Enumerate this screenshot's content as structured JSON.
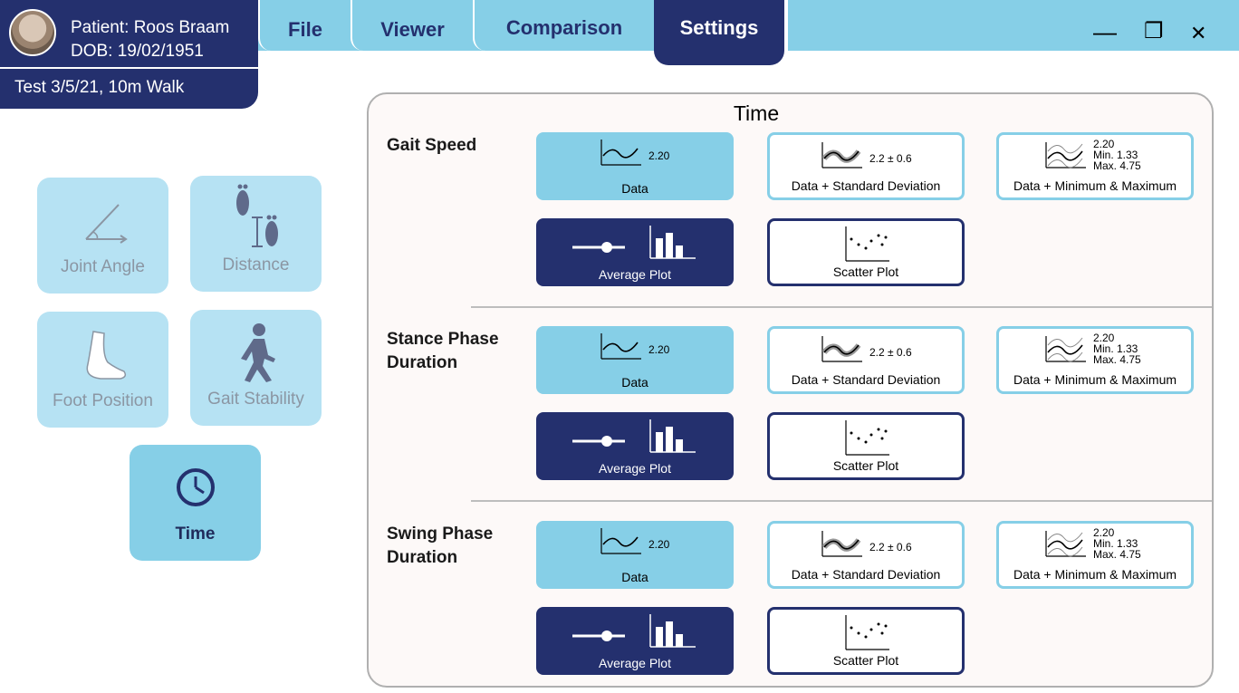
{
  "patient": {
    "name": "Patient: Roos Braam",
    "dob": "DOB: 19/02/1951",
    "test": "Test 3/5/21, 10m Walk"
  },
  "tabs": [
    {
      "label": "File",
      "active": false
    },
    {
      "label": "Viewer",
      "active": false
    },
    {
      "label": "Comparison",
      "active": false
    },
    {
      "label": "Settings",
      "active": true
    }
  ],
  "window_controls": {
    "minimize": "—",
    "restore": "❐",
    "close": "✕"
  },
  "categories": [
    {
      "label": "Joint Angle",
      "icon": "joint-angle-icon",
      "active": false
    },
    {
      "label": "Distance",
      "icon": "footprints-distance-icon",
      "active": false
    },
    {
      "label": "Foot Position",
      "icon": "foot-icon",
      "active": false
    },
    {
      "label": "Gait Stability",
      "icon": "walking-person-icon",
      "active": false
    },
    {
      "label": "Time",
      "icon": "clock-icon",
      "active": true
    }
  ],
  "panel": {
    "title": "Time",
    "metrics": [
      {
        "label_line1": "Gait Speed",
        "label_line2": "",
        "options": {
          "data": {
            "label": "Data",
            "value": "2.20"
          },
          "data_sd": {
            "label": "Data + Standard Deviation",
            "value": "2.2 ± 0.6"
          },
          "data_minmax": {
            "label": "Data + Minimum & Maximum",
            "value": "2.20",
            "min": "Min. 1.33",
            "max": "Max. 4.75"
          },
          "average": {
            "label": "Average Plot"
          },
          "scatter": {
            "label": "Scatter Plot"
          }
        }
      },
      {
        "label_line1": "Stance Phase",
        "label_line2": "Duration",
        "options": {
          "data": {
            "label": "Data",
            "value": "2.20"
          },
          "data_sd": {
            "label": "Data + Standard Deviation",
            "value": "2.2 ± 0.6"
          },
          "data_minmax": {
            "label": "Data + Minimum & Maximum",
            "value": "2.20",
            "min": "Min. 1.33",
            "max": "Max. 4.75"
          },
          "average": {
            "label": "Average Plot"
          },
          "scatter": {
            "label": "Scatter Plot"
          }
        }
      },
      {
        "label_line1": "Swing Phase",
        "label_line2": "Duration",
        "options": {
          "data": {
            "label": "Data",
            "value": "2.20"
          },
          "data_sd": {
            "label": "Data + Standard Deviation",
            "value": "2.2 ± 0.6"
          },
          "data_minmax": {
            "label": "Data + Minimum & Maximum",
            "value": "2.20",
            "min": "Min. 1.33",
            "max": "Max. 4.75"
          },
          "average": {
            "label": "Average Plot"
          },
          "scatter": {
            "label": "Scatter Plot"
          }
        }
      }
    ]
  },
  "colors": {
    "navy": "#24306e",
    "light_blue": "#86cfe7",
    "pale_blue": "#b6e2f3",
    "panel_bg": "#fdf9f8"
  }
}
